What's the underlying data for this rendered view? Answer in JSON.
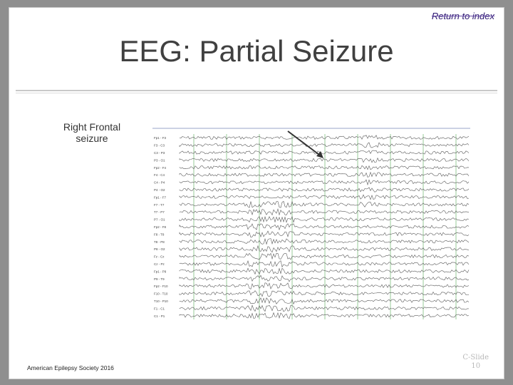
{
  "slide": {
    "return_link": "Return to index",
    "title": "EEG: Partial Seizure",
    "caption": "Right Frontal seizure",
    "footer": "American Epilepsy Society 2016",
    "slide_label": "C-Slide",
    "slide_number": "10"
  },
  "eeg": {
    "montage_labels": [
      "Fp1 - F3",
      "F3 - C3",
      "C3 - P3",
      "P3 - O1",
      "Fp2 - F4",
      "F4 - C4",
      "C4 - P4",
      "P4 - O2",
      "Fp1 - F7",
      "F7 - T7",
      "T7 - P7",
      "P7 - O1",
      "Fp2 - F8",
      "F8 - T8",
      "T8 - P8",
      "P8 - O2",
      "Fz - Cz",
      "Cz - Pz",
      "Fp1 - P9",
      "P9 - T9",
      "Fp2 - F10",
      "F10 - T10",
      "T10 - P10",
      "F1 - C1",
      "C1 - P1"
    ],
    "colors": {
      "trace": "#5a5a5a",
      "grid": "#7fbf7f",
      "arrow": "#333333"
    }
  }
}
